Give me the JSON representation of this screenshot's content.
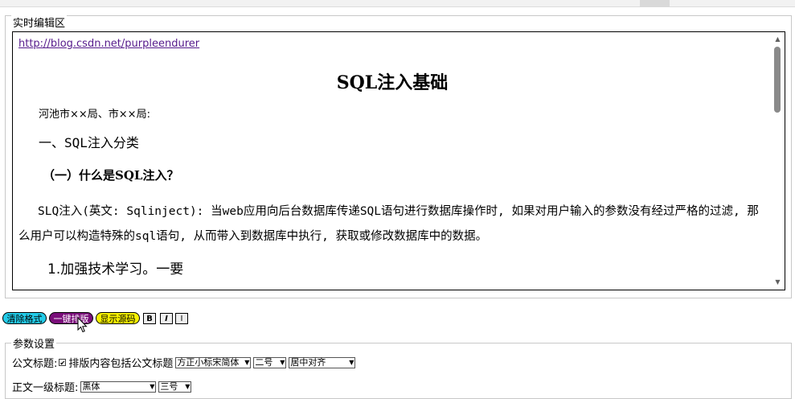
{
  "editor": {
    "legend": "实时编辑区",
    "link": "http://blog.csdn.net/purpleendurer",
    "title": "SQL注入基础",
    "recipient": "河池市××局、市××局:",
    "heading1": "一、SQL注入分类",
    "heading2": "（一）什么是SQL注入？",
    "paragraph": "SLQ注入(英文: Sqlinject): 当web应用向后台数据库传递SQL语句进行数据库操作时, 如果对用户输入的参数没有经过严格的过滤, 那么用户可以构造特殊的sql语句, 从而带入到数据库中执行, 获取或修改数据库中的数据。",
    "item": "1.加强技术学习。一要"
  },
  "toolbar": {
    "clear_label": "清除格式",
    "format_label": "一键排版",
    "source_label": "显示源码",
    "bold_label": "B",
    "italic_label": "I",
    "underline_label": "I"
  },
  "colors": {
    "clear_btn": "#22cbe8",
    "format_btn": "#7a0e7a",
    "source_btn": "#f7f100",
    "link": "#551a8b"
  },
  "params": {
    "legend": "参数设置",
    "row1": {
      "label": "公文标题:",
      "checkbox_label": "排版内容包括公文标题",
      "checked": true,
      "font_select": "方正小标宋简体",
      "size_select": "二号",
      "align_select": "居中对齐"
    },
    "row2": {
      "label": "正文一级标题:",
      "font_select": "黑体",
      "size_select": "三号"
    }
  },
  "icons": {
    "checkbox": "check-mark",
    "scroll_up": "triangle-up",
    "scroll_down": "triangle-down",
    "select_arrow": "chevron-down",
    "cursor": "mouse-pointer"
  }
}
